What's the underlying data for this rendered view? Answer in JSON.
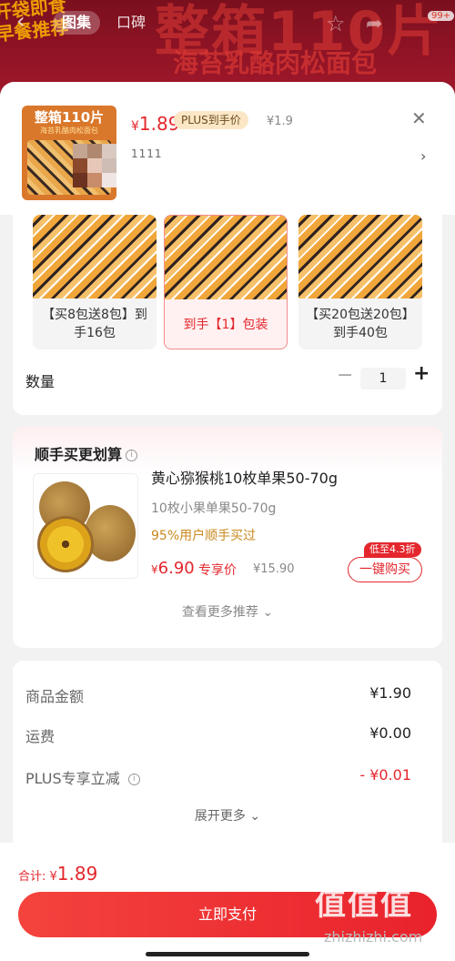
{
  "background": {
    "banner_left": "开袋即食\n早餐推荐",
    "banner_big": "整箱110片",
    "banner_sub": "海苔乳酪肉松面包",
    "nav": {
      "back_icon": "chevron-left-icon",
      "tab_active": "图集",
      "tab_2": "口碑",
      "badge": "99+"
    }
  },
  "product": {
    "thumb_title": "整箱110片",
    "thumb_sub": "海苔乳酪肉松面包",
    "price_symbol": "¥",
    "price": "1.89",
    "plus_label": "PLUS到手价",
    "orig_price": "¥1.9",
    "spec_line": "1111"
  },
  "options": [
    {
      "label": "【买8包送8包】到手16包"
    },
    {
      "label": "到手【1】包装"
    },
    {
      "label": "【买20包送20包】到手40包"
    }
  ],
  "quantity": {
    "label": "数量",
    "minus": "−",
    "value": "1",
    "plus": "+"
  },
  "addon": {
    "title": "顺手买更划算",
    "info": "i",
    "name": "黄心猕猴桃10枚单果50-70g",
    "spec": "10枚小果单果50-70g",
    "social": "95%用户顺手买过",
    "price_symbol": "¥",
    "price": "6.90",
    "exclusive": "专享价",
    "orig_price": "¥15.90",
    "discount_tag": "低至4.3折",
    "buy_label": "一键购买",
    "more_label": "查看更多推荐"
  },
  "summary": {
    "rows": [
      {
        "label": "商品金额",
        "value": "¥1.90"
      },
      {
        "label": "运费",
        "value": "¥0.00"
      },
      {
        "label": "PLUS专享立减",
        "value": "- ¥0.01"
      }
    ],
    "expand_label": "展开更多"
  },
  "footer": {
    "total_label": "合计: ",
    "total_symbol": "¥",
    "total_value": "1.89",
    "pay_label": "立即支付",
    "watermark": "值值值",
    "watermark_sub": "zhizhizhi.com"
  },
  "colors": {
    "accent": "#e4272d",
    "plus_bg": "#fbe7c6"
  }
}
